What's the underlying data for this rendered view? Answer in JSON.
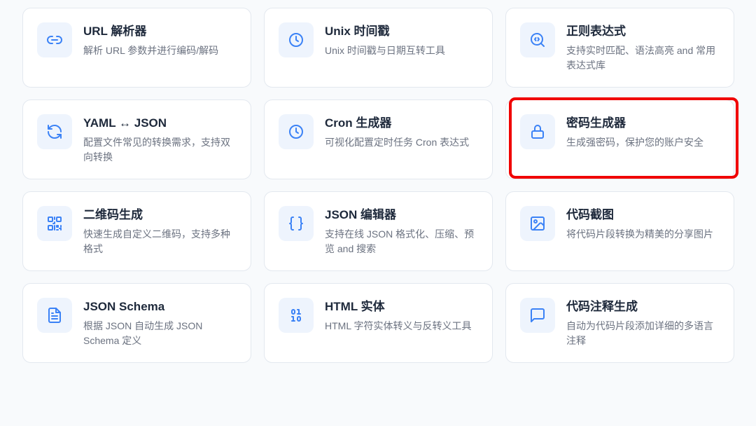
{
  "tools": [
    {
      "id": "url-parser",
      "icon": "link-icon",
      "title": "URL 解析器",
      "desc": "解析 URL 参数并进行编码/解码"
    },
    {
      "id": "unix-timestamp",
      "icon": "clock-icon",
      "title": "Unix 时间戳",
      "desc": "Unix 时间戳与日期互转工具"
    },
    {
      "id": "regex",
      "icon": "search-code-icon",
      "title": "正则表达式",
      "desc": "支持实时匹配、语法高亮 and 常用表达式库"
    },
    {
      "id": "yaml-json",
      "icon": "refresh-icon",
      "title": "YAML ↔ JSON",
      "desc": "配置文件常见的转换需求，支持双向转换"
    },
    {
      "id": "cron",
      "icon": "clock-icon",
      "title": "Cron 生成器",
      "desc": "可视化配置定时任务 Cron 表达式"
    },
    {
      "id": "password",
      "icon": "lock-icon",
      "title": "密码生成器",
      "desc": "生成强密码，保护您的账户安全"
    },
    {
      "id": "qrcode",
      "icon": "qr-code-icon",
      "title": "二维码生成",
      "desc": "快速生成自定义二维码，支持多种格式"
    },
    {
      "id": "json-editor",
      "icon": "braces-icon",
      "title": "JSON 编辑器",
      "desc": "支持在线 JSON 格式化、压缩、预览 and 搜索"
    },
    {
      "id": "code-screenshot",
      "icon": "image-icon",
      "title": "代码截图",
      "desc": "将代码片段转换为精美的分享图片"
    },
    {
      "id": "json-schema",
      "icon": "file-text-icon",
      "title": "JSON Schema",
      "desc": "根据 JSON 自动生成 JSON Schema 定义"
    },
    {
      "id": "html-entity",
      "icon": "binary-icon",
      "title": "HTML 实体",
      "desc": "HTML 字符实体转义与反转义工具"
    },
    {
      "id": "code-comment",
      "icon": "message-square-icon",
      "title": "代码注释生成",
      "desc": "自动为代码片段添加详细的多语言注释"
    }
  ],
  "highlighted_tool": "password",
  "colors": {
    "accent": "#3b82f6",
    "icon_bg": "#eef4fd",
    "highlight": "#f00000"
  }
}
